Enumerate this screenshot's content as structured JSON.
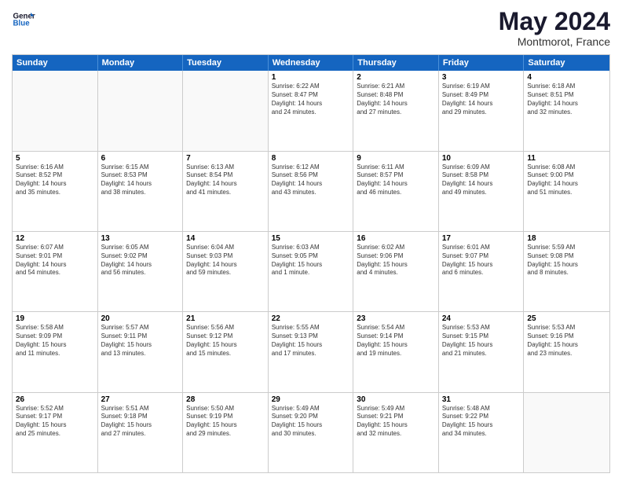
{
  "logo": {
    "line1": "General",
    "line2": "Blue"
  },
  "title": "May 2024",
  "location": "Montmorot, France",
  "days_of_week": [
    "Sunday",
    "Monday",
    "Tuesday",
    "Wednesday",
    "Thursday",
    "Friday",
    "Saturday"
  ],
  "weeks": [
    [
      {
        "day": "",
        "lines": [],
        "empty": true
      },
      {
        "day": "",
        "lines": [],
        "empty": true
      },
      {
        "day": "",
        "lines": [],
        "empty": true
      },
      {
        "day": "1",
        "lines": [
          "Sunrise: 6:22 AM",
          "Sunset: 8:47 PM",
          "Daylight: 14 hours",
          "and 24 minutes."
        ]
      },
      {
        "day": "2",
        "lines": [
          "Sunrise: 6:21 AM",
          "Sunset: 8:48 PM",
          "Daylight: 14 hours",
          "and 27 minutes."
        ]
      },
      {
        "day": "3",
        "lines": [
          "Sunrise: 6:19 AM",
          "Sunset: 8:49 PM",
          "Daylight: 14 hours",
          "and 29 minutes."
        ]
      },
      {
        "day": "4",
        "lines": [
          "Sunrise: 6:18 AM",
          "Sunset: 8:51 PM",
          "Daylight: 14 hours",
          "and 32 minutes."
        ]
      }
    ],
    [
      {
        "day": "5",
        "lines": [
          "Sunrise: 6:16 AM",
          "Sunset: 8:52 PM",
          "Daylight: 14 hours",
          "and 35 minutes."
        ]
      },
      {
        "day": "6",
        "lines": [
          "Sunrise: 6:15 AM",
          "Sunset: 8:53 PM",
          "Daylight: 14 hours",
          "and 38 minutes."
        ]
      },
      {
        "day": "7",
        "lines": [
          "Sunrise: 6:13 AM",
          "Sunset: 8:54 PM",
          "Daylight: 14 hours",
          "and 41 minutes."
        ]
      },
      {
        "day": "8",
        "lines": [
          "Sunrise: 6:12 AM",
          "Sunset: 8:56 PM",
          "Daylight: 14 hours",
          "and 43 minutes."
        ]
      },
      {
        "day": "9",
        "lines": [
          "Sunrise: 6:11 AM",
          "Sunset: 8:57 PM",
          "Daylight: 14 hours",
          "and 46 minutes."
        ]
      },
      {
        "day": "10",
        "lines": [
          "Sunrise: 6:09 AM",
          "Sunset: 8:58 PM",
          "Daylight: 14 hours",
          "and 49 minutes."
        ]
      },
      {
        "day": "11",
        "lines": [
          "Sunrise: 6:08 AM",
          "Sunset: 9:00 PM",
          "Daylight: 14 hours",
          "and 51 minutes."
        ]
      }
    ],
    [
      {
        "day": "12",
        "lines": [
          "Sunrise: 6:07 AM",
          "Sunset: 9:01 PM",
          "Daylight: 14 hours",
          "and 54 minutes."
        ]
      },
      {
        "day": "13",
        "lines": [
          "Sunrise: 6:05 AM",
          "Sunset: 9:02 PM",
          "Daylight: 14 hours",
          "and 56 minutes."
        ]
      },
      {
        "day": "14",
        "lines": [
          "Sunrise: 6:04 AM",
          "Sunset: 9:03 PM",
          "Daylight: 14 hours",
          "and 59 minutes."
        ]
      },
      {
        "day": "15",
        "lines": [
          "Sunrise: 6:03 AM",
          "Sunset: 9:05 PM",
          "Daylight: 15 hours",
          "and 1 minute."
        ]
      },
      {
        "day": "16",
        "lines": [
          "Sunrise: 6:02 AM",
          "Sunset: 9:06 PM",
          "Daylight: 15 hours",
          "and 4 minutes."
        ]
      },
      {
        "day": "17",
        "lines": [
          "Sunrise: 6:01 AM",
          "Sunset: 9:07 PM",
          "Daylight: 15 hours",
          "and 6 minutes."
        ]
      },
      {
        "day": "18",
        "lines": [
          "Sunrise: 5:59 AM",
          "Sunset: 9:08 PM",
          "Daylight: 15 hours",
          "and 8 minutes."
        ]
      }
    ],
    [
      {
        "day": "19",
        "lines": [
          "Sunrise: 5:58 AM",
          "Sunset: 9:09 PM",
          "Daylight: 15 hours",
          "and 11 minutes."
        ]
      },
      {
        "day": "20",
        "lines": [
          "Sunrise: 5:57 AM",
          "Sunset: 9:11 PM",
          "Daylight: 15 hours",
          "and 13 minutes."
        ]
      },
      {
        "day": "21",
        "lines": [
          "Sunrise: 5:56 AM",
          "Sunset: 9:12 PM",
          "Daylight: 15 hours",
          "and 15 minutes."
        ]
      },
      {
        "day": "22",
        "lines": [
          "Sunrise: 5:55 AM",
          "Sunset: 9:13 PM",
          "Daylight: 15 hours",
          "and 17 minutes."
        ]
      },
      {
        "day": "23",
        "lines": [
          "Sunrise: 5:54 AM",
          "Sunset: 9:14 PM",
          "Daylight: 15 hours",
          "and 19 minutes."
        ]
      },
      {
        "day": "24",
        "lines": [
          "Sunrise: 5:53 AM",
          "Sunset: 9:15 PM",
          "Daylight: 15 hours",
          "and 21 minutes."
        ]
      },
      {
        "day": "25",
        "lines": [
          "Sunrise: 5:53 AM",
          "Sunset: 9:16 PM",
          "Daylight: 15 hours",
          "and 23 minutes."
        ]
      }
    ],
    [
      {
        "day": "26",
        "lines": [
          "Sunrise: 5:52 AM",
          "Sunset: 9:17 PM",
          "Daylight: 15 hours",
          "and 25 minutes."
        ]
      },
      {
        "day": "27",
        "lines": [
          "Sunrise: 5:51 AM",
          "Sunset: 9:18 PM",
          "Daylight: 15 hours",
          "and 27 minutes."
        ]
      },
      {
        "day": "28",
        "lines": [
          "Sunrise: 5:50 AM",
          "Sunset: 9:19 PM",
          "Daylight: 15 hours",
          "and 29 minutes."
        ]
      },
      {
        "day": "29",
        "lines": [
          "Sunrise: 5:49 AM",
          "Sunset: 9:20 PM",
          "Daylight: 15 hours",
          "and 30 minutes."
        ]
      },
      {
        "day": "30",
        "lines": [
          "Sunrise: 5:49 AM",
          "Sunset: 9:21 PM",
          "Daylight: 15 hours",
          "and 32 minutes."
        ]
      },
      {
        "day": "31",
        "lines": [
          "Sunrise: 5:48 AM",
          "Sunset: 9:22 PM",
          "Daylight: 15 hours",
          "and 34 minutes."
        ]
      },
      {
        "day": "",
        "lines": [],
        "empty": true
      }
    ]
  ]
}
